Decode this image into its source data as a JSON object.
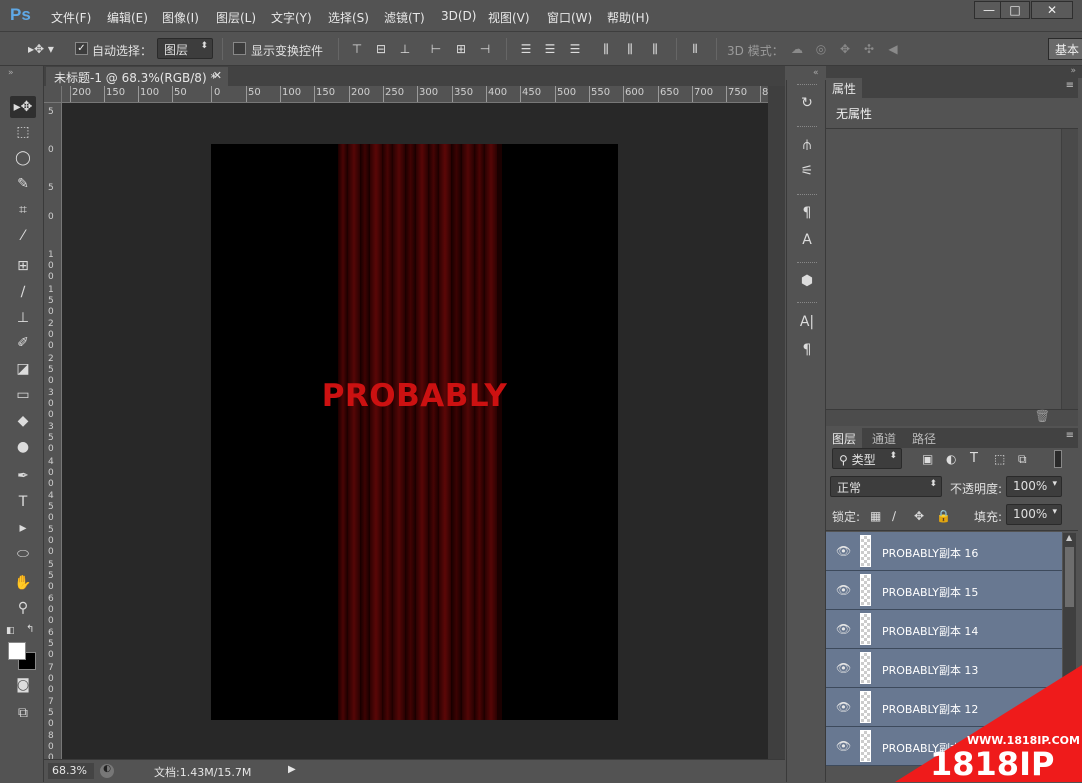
{
  "app": {
    "logo": "Ps",
    "window_controls": [
      "—",
      "□",
      "✕"
    ]
  },
  "menu": [
    "文件(F)",
    "编辑(E)",
    "图像(I)",
    "图层(L)",
    "文字(Y)",
    "选择(S)",
    "滤镜(T)",
    "3D(D)",
    "视图(V)",
    "窗口(W)",
    "帮助(H)"
  ],
  "options": {
    "auto_select_label": "自动选择：",
    "auto_select_checked": true,
    "auto_select_target": "图层",
    "show_transform_label": "显示变换控件",
    "mode_3d_label": "3D 模式：",
    "workspace": "基本"
  },
  "document": {
    "tab_title": "未标题-1 @ 68.3%(RGB/8) *",
    "text": "PROBABLY",
    "zoom": "68.3%",
    "doc_info": "文档:1.43M/15.7M"
  },
  "ruler": {
    "h_ticks": [
      "200",
      "150",
      "100",
      "50",
      "0",
      "50",
      "100",
      "150",
      "200",
      "250",
      "300",
      "350",
      "400",
      "450",
      "500",
      "550",
      "600",
      "650",
      "700",
      "750",
      "8"
    ],
    "v_ticks": [
      "5",
      "0",
      "5",
      "0",
      "1\n0\n0",
      "1\n5\n0",
      "2\n0\n0",
      "2\n5\n0",
      "3\n0\n0",
      "3\n5\n0",
      "4\n0\n0",
      "4\n5\n0",
      "5\n0\n0",
      "5\n5\n0",
      "6\n0\n0",
      "6\n5\n0",
      "7\n0\n0",
      "7\n5\n0",
      "8\n0\n0",
      "8\n5\n0"
    ]
  },
  "properties_panel": {
    "tab": "属性",
    "content": "无属性"
  },
  "layers_panel": {
    "tabs": [
      "图层",
      "通道",
      "路径"
    ],
    "filter_label": "类型",
    "blend_mode": "正常",
    "opacity_label": "不透明度:",
    "opacity_value": "100%",
    "lock_label": "锁定:",
    "fill_label": "填充:",
    "fill_value": "100%",
    "layers": [
      {
        "name": "PROBABLY副本 16"
      },
      {
        "name": "PROBABLY副本 15"
      },
      {
        "name": "PROBABLY副本 14"
      },
      {
        "name": "PROBABLY副本 13"
      },
      {
        "name": "PROBABLY副本 12"
      },
      {
        "name": "PROBABLY副本 11"
      }
    ]
  },
  "watermark": {
    "url": "WWW.1818IP.COM",
    "brand": "1818IP"
  },
  "colors": {
    "accent_red": "#cc1111",
    "layer_selected": "#687891",
    "ps_blue": "#5fa8e6"
  }
}
